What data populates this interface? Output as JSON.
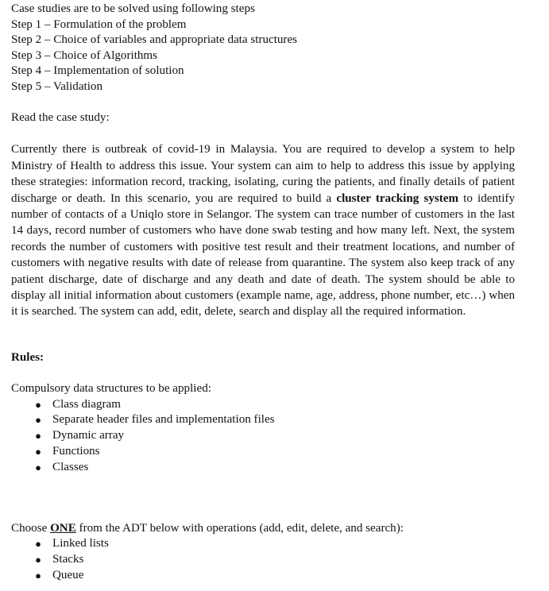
{
  "document": {
    "intro_heading": "Case studies are to be solved using following steps",
    "steps": [
      "Step 1 – Formulation of the problem",
      "Step 2 – Choice of variables and appropriate data structures",
      "Step 3 – Choice of Algorithms",
      "Step 4 – Implementation of solution",
      "Step 5 – Validation"
    ],
    "read_prompt": "Read the case study:",
    "case_study": {
      "part1": "Currently there is outbreak of covid-19 in Malaysia. You are required to develop a system to help Ministry of Health to address this issue. Your system can aim to help to address this issue by applying these strategies: information record, tracking, isolating, curing the patients, and finally details of patient discharge or death. In this scenario, you are required to build a ",
      "bold_term": "cluster tracking system",
      "part2": " to identify number of contacts of a Uniqlo store in Selangor. The system can trace number of customers in the last 14 days, record number of customers who have done swab testing and how many left. Next, the system records the number of customers with positive test result and their treatment locations, and number of customers with negative results with date of release from quarantine. The system also keep track of any patient discharge, date of discharge and any death and date of death. The system should be able to display all initial information about customers (example name, age, address, phone number, etc…) when it is searched. The system can add, edit, delete, search and display all the required information."
    },
    "rules_heading": "Rules:",
    "compulsory_lead": "Compulsory data structures to be applied:",
    "compulsory_items": [
      "Class diagram",
      "Separate header files and implementation files",
      "Dynamic array",
      "Functions",
      "Classes"
    ],
    "adt_choice": {
      "before": "Choose ",
      "emphasis": "ONE",
      "after": " from the ADT below with operations (add, edit, delete, and search):"
    },
    "adt_items": [
      "Linked lists",
      "Stacks",
      "Queue"
    ],
    "bullet_glyph": "●"
  }
}
